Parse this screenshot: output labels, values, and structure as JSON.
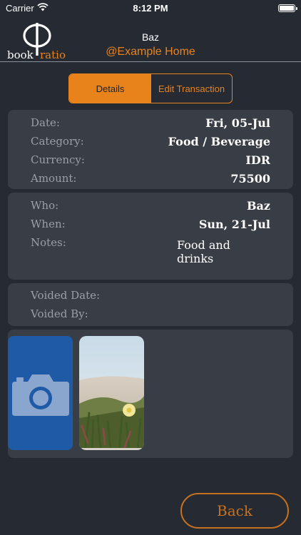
{
  "status_bar": {
    "carrier": "Carrier",
    "time": "8:12 PM"
  },
  "header": {
    "logo_book": "book",
    "logo_ratio": "ratio",
    "user_name": "Baz",
    "home_name": "@Example Home"
  },
  "tabs": {
    "details": "Details",
    "edit": "Edit Transaction",
    "active": "Details"
  },
  "transaction": {
    "date_label": "Date:",
    "date_value": "Fri, 05-Jul",
    "category_label": "Category:",
    "category_value": "Food / Beverage",
    "currency_label": "Currency:",
    "currency_value": "IDR",
    "amount_label": "Amount:",
    "amount_value": "75500"
  },
  "meta": {
    "who_label": "Who:",
    "who_value": "Baz",
    "when_label": "When:",
    "when_value": "Sun, 21-Jul",
    "notes_label": "Notes:",
    "notes_value": "Food and drinks"
  },
  "voided": {
    "date_label": "Voided Date:",
    "by_label": "Voided By:"
  },
  "attachments": {
    "add_icon": "camera-icon"
  },
  "footer": {
    "back_label": "Back"
  },
  "colors": {
    "accent": "#e8831c",
    "background": "#252a33",
    "card": "#393d46",
    "camera_tile": "#1e5aa5"
  }
}
